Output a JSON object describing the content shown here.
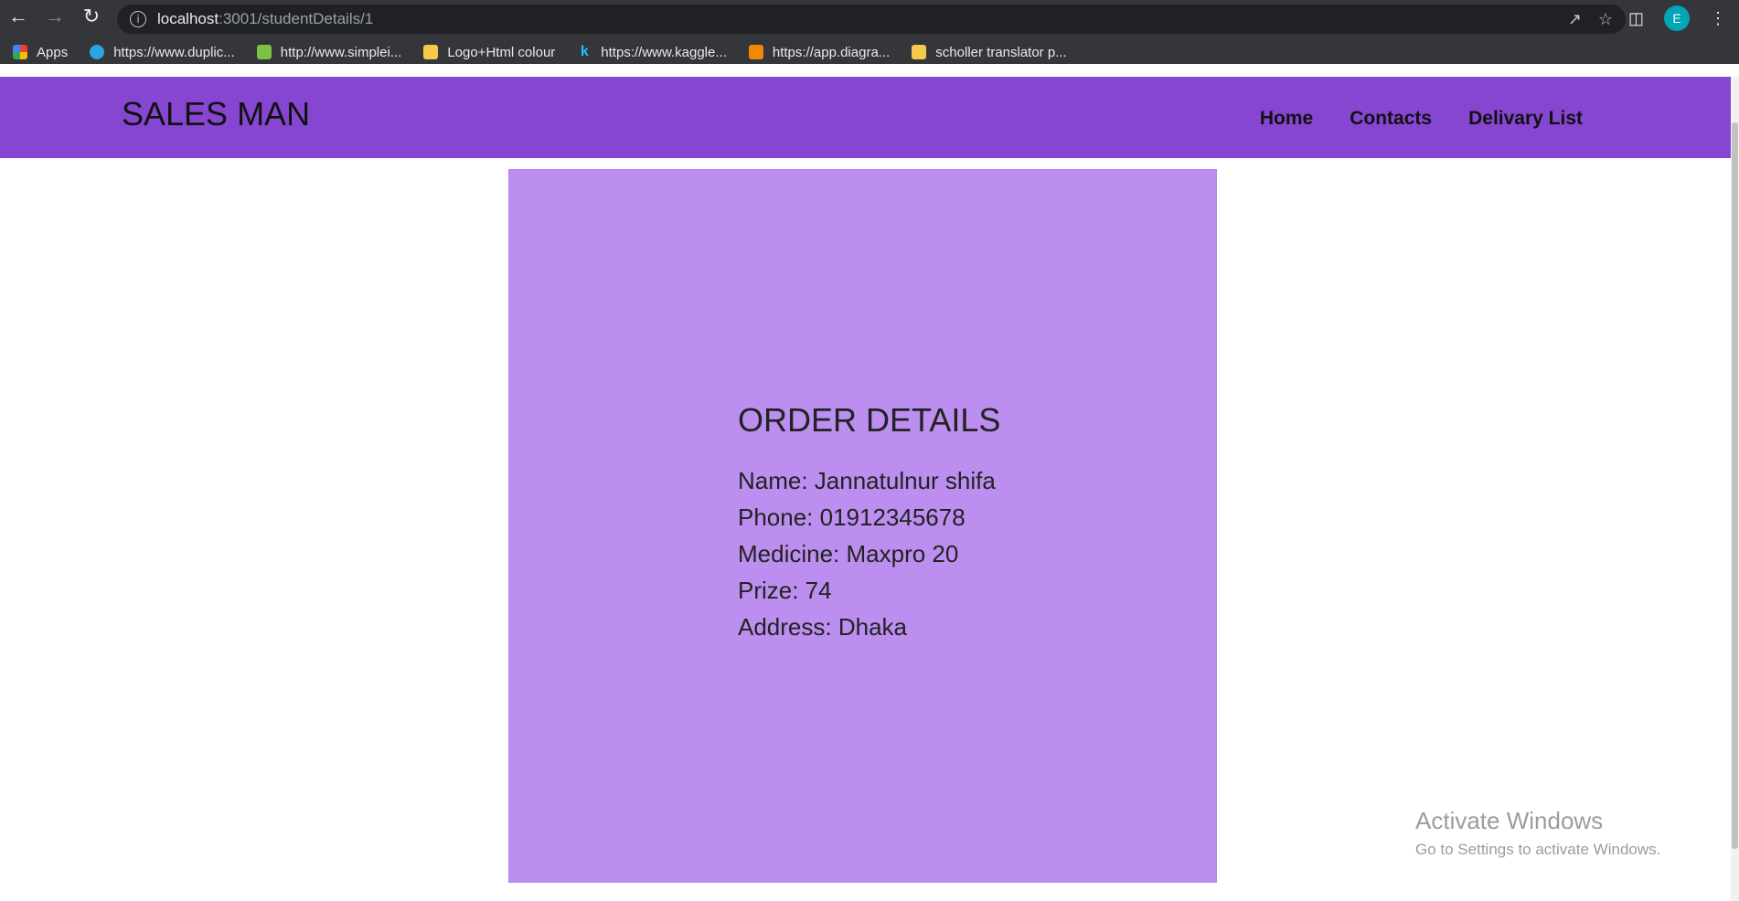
{
  "browser": {
    "url_host": "localhost",
    "url_path": ":3001/studentDetails/1",
    "profile_initial": "E",
    "bookmarks": [
      {
        "label": "Apps",
        "icon": "apps-grid-icon",
        "color": "#e94335"
      },
      {
        "label": "https://www.duplic...",
        "icon": "site-favicon-icon",
        "color": "#2aa5e0"
      },
      {
        "label": "http://www.simplei...",
        "icon": "site-favicon-icon",
        "color": "#7cc244"
      },
      {
        "label": "Logo+Html colour",
        "icon": "folder-icon",
        "color": "#f6c94c"
      },
      {
        "label": "https://www.kaggle...",
        "icon": "kaggle-icon",
        "color": "#20beff"
      },
      {
        "label": "https://app.diagra...",
        "icon": "diagrams-icon",
        "color": "#f08705"
      },
      {
        "label": "scholler translator p...",
        "icon": "folder-icon",
        "color": "#f6c94c"
      }
    ]
  },
  "site": {
    "brand": "SALES MAN",
    "nav": [
      "Home",
      "Contacts",
      "Delivary List"
    ],
    "nav_color": "#8646d2"
  },
  "order": {
    "title": "ORDER DETAILS",
    "name": "Name: Jannatulnur shifa",
    "phone": "Phone: 01912345678",
    "medicine": "Medicine: Maxpro 20",
    "prize": "Prize: 74",
    "address": "Address: Dhaka",
    "card_color": "#bb8eef"
  },
  "watermark": {
    "line1": "Activate Windows",
    "line2": "Go to Settings to activate Windows."
  }
}
